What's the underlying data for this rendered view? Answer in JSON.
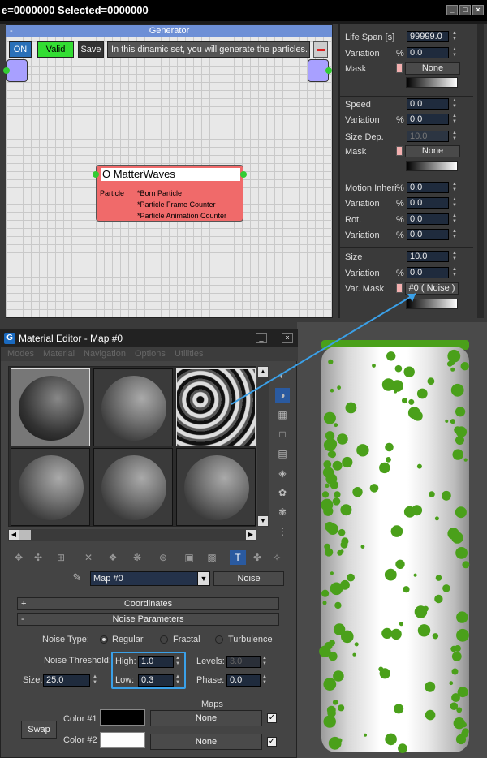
{
  "topbar": {
    "text": "e=0000000  Selected=0000000",
    "min": "_",
    "max": "□",
    "close": "×"
  },
  "generator": {
    "title": "Generator",
    "collapse": "-",
    "on_label": "ON",
    "valid_label": "Valid",
    "save_label": "Save",
    "status_text": "In this dinamic set, you will generate the particles."
  },
  "node": {
    "title": "O MatterWaves",
    "left_label": "Particle",
    "items": [
      "*Born Particle",
      "*Particle Frame Counter",
      "*Particle Animation Counter"
    ]
  },
  "params": {
    "life_span": {
      "label": "Life Span [s]",
      "value": "99999.0"
    },
    "variation1": {
      "label": "Variation",
      "pct": "%",
      "value": "0.0"
    },
    "mask1": {
      "label": "Mask",
      "btn": "None"
    },
    "speed": {
      "label": "Speed",
      "value": "0.0"
    },
    "variation2": {
      "label": "Variation",
      "pct": "%",
      "value": "0.0"
    },
    "size_dep": {
      "label": "Size Dep.",
      "value": "10.0"
    },
    "mask2": {
      "label": "Mask",
      "btn": "None"
    },
    "motion": {
      "label": "Motion Inheri",
      "pct": "%",
      "value": "0.0"
    },
    "variation3": {
      "label": "Variation",
      "pct": "%",
      "value": "0.0"
    },
    "rot": {
      "label": "Rot.",
      "pct": "%",
      "value": "0.0"
    },
    "variation4": {
      "label": "Variation",
      "pct": "%",
      "value": "0.0"
    },
    "size": {
      "label": "Size",
      "value": "10.0"
    },
    "variation5": {
      "label": "Variation",
      "pct": "%",
      "value": "0.0"
    },
    "var_mask": {
      "label": "Var. Mask",
      "btn": "#0  ( Noise )"
    }
  },
  "material_editor": {
    "title": "Material Editor - Map #0",
    "min": "_",
    "close": "×",
    "menu": [
      "Modes",
      "Material",
      "Navigation",
      "Options",
      "Utilities"
    ],
    "map_name": "Map #0",
    "map_type": "Noise",
    "rollouts": {
      "coordinates": "Coordinates",
      "noise_params": "Noise Parameters",
      "plus": "+",
      "minus": "-"
    },
    "noise_type_label": "Noise Type:",
    "noise_types": [
      "Regular",
      "Fractal",
      "Turbulence"
    ],
    "noise_threshold_label": "Noise Threshold:",
    "high_label": "High:",
    "high_value": "1.0",
    "low_label": "Low:",
    "low_value": "0.3",
    "levels_label": "Levels:",
    "levels_value": "3.0",
    "size_label": "Size:",
    "size_value": "25.0",
    "phase_label": "Phase:",
    "phase_value": "0.0",
    "maps_label": "Maps",
    "swap_label": "Swap",
    "color1_label": "Color #1",
    "color1_map": "None",
    "color2_label": "Color #2",
    "color2_map": "None"
  },
  "colors": {
    "accent": "#3aa0e8",
    "valid": "#33dd33",
    "node": "#f06a6a",
    "particles": "#4aa01a"
  }
}
